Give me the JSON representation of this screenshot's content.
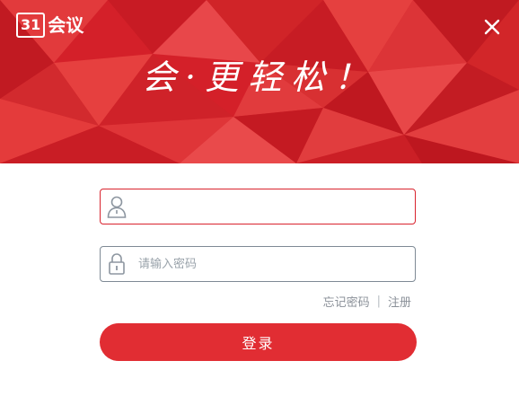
{
  "window": {
    "accent_color": "#d9232e",
    "button_color": "#e12d33"
  },
  "logo": {
    "mark": "31",
    "text": "会议"
  },
  "banner": {
    "slogan": "会·更轻松！"
  },
  "form": {
    "username": {
      "value": "",
      "placeholder": "",
      "icon": "user-icon"
    },
    "password": {
      "value": "",
      "placeholder": "请输入密码",
      "icon": "lock-icon"
    },
    "forgot_password_label": "忘记密码",
    "separator": "|",
    "register_label": "注册",
    "login_label": "登录"
  },
  "controls": {
    "close_icon": "close-icon"
  }
}
